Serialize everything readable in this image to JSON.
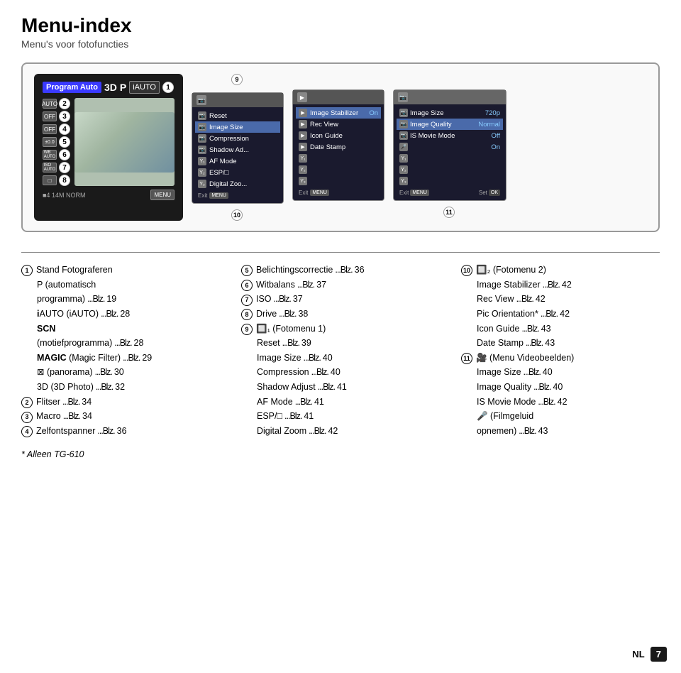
{
  "title": "Menu-index",
  "subtitle": "Menu's voor fotofuncties",
  "diagram": {
    "camera": {
      "program_label": "Program Auto",
      "badge_3d": "3D",
      "badge_p": "P",
      "badge_iauto": "iAUTO",
      "num1": "1",
      "settings": [
        {
          "icon": "AUTO",
          "num": "2"
        },
        {
          "icon": "OFF",
          "num": "3"
        },
        {
          "icon": "OFF",
          "num": "4"
        },
        {
          "icon": "±0.0",
          "num": "5"
        },
        {
          "icon": "WB AUTO",
          "num": "6"
        },
        {
          "icon": "ISO AUTO",
          "num": "7"
        },
        {
          "icon": "□",
          "num": "8"
        }
      ],
      "bottom_left": "■4 14M NORM",
      "menu_btn": "MENU"
    },
    "num9": "9",
    "num10": "10",
    "num11": "11",
    "menu1": {
      "items": [
        {
          "icon": "📷",
          "label": "Reset"
        },
        {
          "icon": "📷",
          "label": "Image Size"
        },
        {
          "icon": "📷",
          "label": "Compression"
        },
        {
          "icon": "📷",
          "label": "Shadow Ad..."
        },
        {
          "icon": "Y1",
          "label": "AF Mode"
        },
        {
          "icon": "Y2",
          "label": "ESP/□"
        },
        {
          "icon": "Y2",
          "label": "Digital Zoo..."
        }
      ],
      "exit": "Exit",
      "exit_btn": "MENU"
    },
    "menu2": {
      "items": [
        {
          "icon": "▶",
          "label": "Image Stabilizer",
          "value": "On"
        },
        {
          "icon": "▶",
          "label": "Rec View"
        },
        {
          "icon": "▶",
          "label": "Icon Guide"
        },
        {
          "icon": "▶",
          "label": "Date Stamp"
        },
        {
          "icon": "Y1"
        },
        {
          "icon": "Y2"
        },
        {
          "icon": "Y3"
        }
      ],
      "exit": "Exit",
      "exit_btn": "MENU"
    },
    "menu3": {
      "items": [
        {
          "icon": "📷",
          "label": "Image Size",
          "value": "720p"
        },
        {
          "icon": "📷",
          "label": "Image Quality",
          "value": "Normal"
        },
        {
          "icon": "📷",
          "label": "IS Movie Mode",
          "value": "Off"
        },
        {
          "icon": "🎤",
          "label": "",
          "value": "On"
        },
        {
          "icon": "Y1"
        },
        {
          "icon": "Y2"
        },
        {
          "icon": "Y3"
        }
      ],
      "exit": "Exit",
      "exit_btn": "MENU",
      "set_btn": "Set OK"
    }
  },
  "columns": {
    "col1": {
      "heading": null,
      "items": [
        {
          "circle": "1",
          "label": "Stand Fotograferen"
        },
        {
          "indent": true,
          "label": "P (automatisch"
        },
        {
          "indent": true,
          "label": "programma)",
          "dots": "...Blz.",
          "page": "19"
        },
        {
          "indent": true,
          "label": "iAUTO (iAUTO)",
          "dots": "...Blz.",
          "page": "28"
        },
        {
          "indent": true,
          "label": "SCN"
        },
        {
          "indent": true,
          "label": "(motiefprogramma)",
          "dots": "...Blz.",
          "page": "28"
        },
        {
          "indent": true,
          "label": "MAGIC (Magic Filter)",
          "dots": "...Blz.",
          "page": "29"
        },
        {
          "indent": true,
          "label": "⊠ (panorama)",
          "dots": "...Blz.",
          "page": "30"
        },
        {
          "indent": true,
          "label": "3D (3D Photo)",
          "dots": "...Blz.",
          "page": "32"
        },
        {
          "circle": "2",
          "label": "Flitser",
          "dots": "...Blz.",
          "page": "34"
        },
        {
          "circle": "3",
          "label": "Macro",
          "dots": "...Blz.",
          "page": "34"
        },
        {
          "circle": "4",
          "label": "Zelfontspanner",
          "dots": "...Blz.",
          "page": "36"
        }
      ],
      "footnote": "* Alleen TG-610"
    },
    "col2": {
      "items": [
        {
          "circle": "5",
          "label": "Belichtingscorrectie",
          "dots": "...Blz.",
          "page": "36"
        },
        {
          "circle": "6",
          "label": "Witbalans",
          "dots": "...Blz.",
          "page": "37"
        },
        {
          "circle": "7",
          "label": "ISO",
          "dots": "...Blz.",
          "page": "37"
        },
        {
          "circle": "8",
          "label": "Drive",
          "dots": "...Blz.",
          "page": "38"
        },
        {
          "circle": "9",
          "label": "🔲₁ (Fotomenu 1)"
        },
        {
          "indent": true,
          "label": "Reset",
          "dots": "...Blz.",
          "page": "39"
        },
        {
          "indent": true,
          "label": "Image Size",
          "dots": "...Blz.",
          "page": "40"
        },
        {
          "indent": true,
          "label": "Compression",
          "dots": "...Blz.",
          "page": "40"
        },
        {
          "indent": true,
          "label": "Shadow Adjust",
          "dots": "...Blz.",
          "page": "41"
        },
        {
          "indent": true,
          "label": "AF Mode",
          "dots": "...Blz.",
          "page": "41"
        },
        {
          "indent": true,
          "label": "ESP/□",
          "dots": "...Blz.",
          "page": "41"
        },
        {
          "indent": true,
          "label": "Digital Zoom",
          "dots": "...Blz.",
          "page": "42"
        }
      ]
    },
    "col3": {
      "items": [
        {
          "circle": "10",
          "label": "🔲₂ (Fotomenu 2)"
        },
        {
          "indent": true,
          "label": "Image Stabilizer",
          "dots": "...Blz.",
          "page": "42"
        },
        {
          "indent": true,
          "label": "Rec View",
          "dots": "...Blz.",
          "page": "42"
        },
        {
          "indent": true,
          "label": "Pic Orientation*",
          "dots": "...Blz.",
          "page": "42"
        },
        {
          "indent": true,
          "label": "Icon Guide",
          "dots": "...Blz.",
          "page": "43"
        },
        {
          "indent": true,
          "label": "Date Stamp",
          "dots": "...Blz.",
          "page": "43"
        },
        {
          "circle": "11",
          "label": "🎥 (Menu Videobeelden)"
        },
        {
          "indent": true,
          "label": "Image Size",
          "dots": "...Blz.",
          "page": "40"
        },
        {
          "indent": true,
          "label": "Image Quality",
          "dots": "...Blz.",
          "page": "40"
        },
        {
          "indent": true,
          "label": "IS Movie Mode",
          "dots": "...Blz.",
          "page": "42"
        },
        {
          "indent": true,
          "label": "🎤 (Filmgeluid"
        },
        {
          "indent": true,
          "label": "opnemen)",
          "dots": "...Blz.",
          "page": "43"
        }
      ]
    }
  },
  "bottom": {
    "lang": "NL",
    "page": "7"
  }
}
